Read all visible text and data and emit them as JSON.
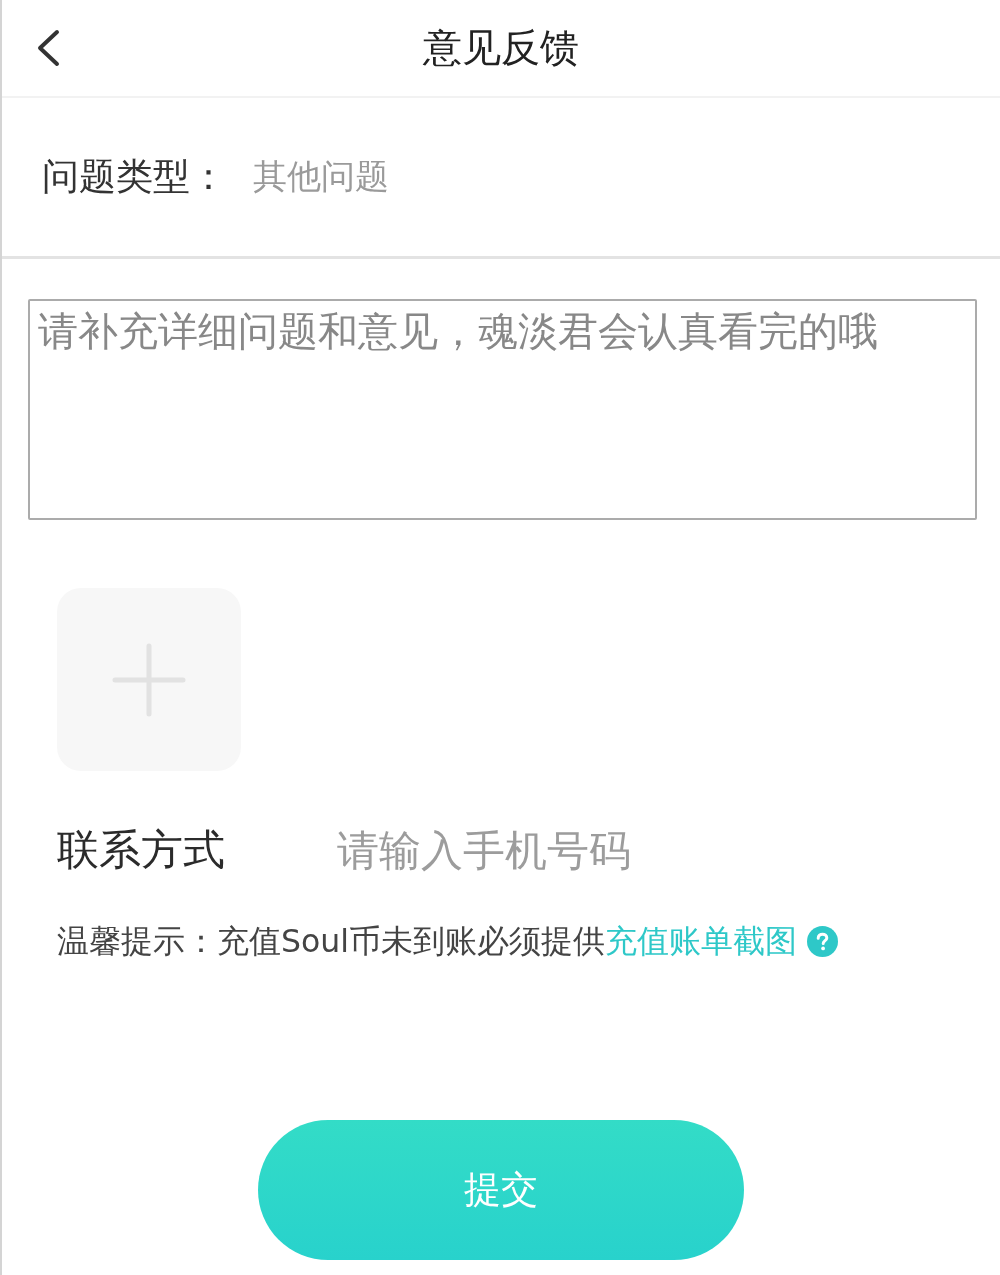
{
  "header": {
    "title": "意见反馈"
  },
  "issue_type": {
    "label": "问题类型：",
    "value": "其他问题"
  },
  "description": {
    "placeholder": "请补充详细问题和意见，魂淡君会认真看完的哦"
  },
  "contact": {
    "label": "联系方式",
    "placeholder": "请输入手机号码"
  },
  "notice": {
    "text": "温馨提示：充值Soul币未到账必须提供",
    "link": "充值账单截图"
  },
  "submit": {
    "label": "提交"
  }
}
